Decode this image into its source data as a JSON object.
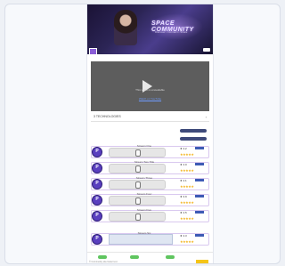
{
  "banner": {
    "title": "SPACE COMMUNITY",
    "subtitle": "Discover • Connect • Share"
  },
  "video": {
    "caption": "This video is unavailable",
    "link_text": "Watch on YouTube",
    "title": "3 TECHNOLOGIES",
    "chevron": "›"
  },
  "rows": [
    {
      "title": "Stream One",
      "meta": "★ 4.2",
      "stars": "★★★★★",
      "avatar": "P"
    },
    {
      "title": "Stream Two Title",
      "meta": "★ 4.0",
      "stars": "★★★★★",
      "avatar": "P"
    },
    {
      "title": "Stream Three",
      "meta": "★ 4.1",
      "stars": "★★★★★",
      "avatar": "P"
    },
    {
      "title": "Stream Four",
      "meta": "★ 3.9",
      "stars": "★★★★★",
      "avatar": "P"
    },
    {
      "title": "Stream Five",
      "meta": "★ 4.5",
      "stars": "★★★★★",
      "avatar": "P"
    },
    {
      "title": "Stream Six",
      "meta": "★ 4.3",
      "stars": "★★★★★",
      "avatar": "P"
    }
  ],
  "footer": {
    "text": "© Community site footer text"
  },
  "colors": {
    "accent": "#5a3fbf",
    "star": "#f3b21b",
    "pill": "#3e4a7a",
    "button_green": "#5fc55f"
  }
}
